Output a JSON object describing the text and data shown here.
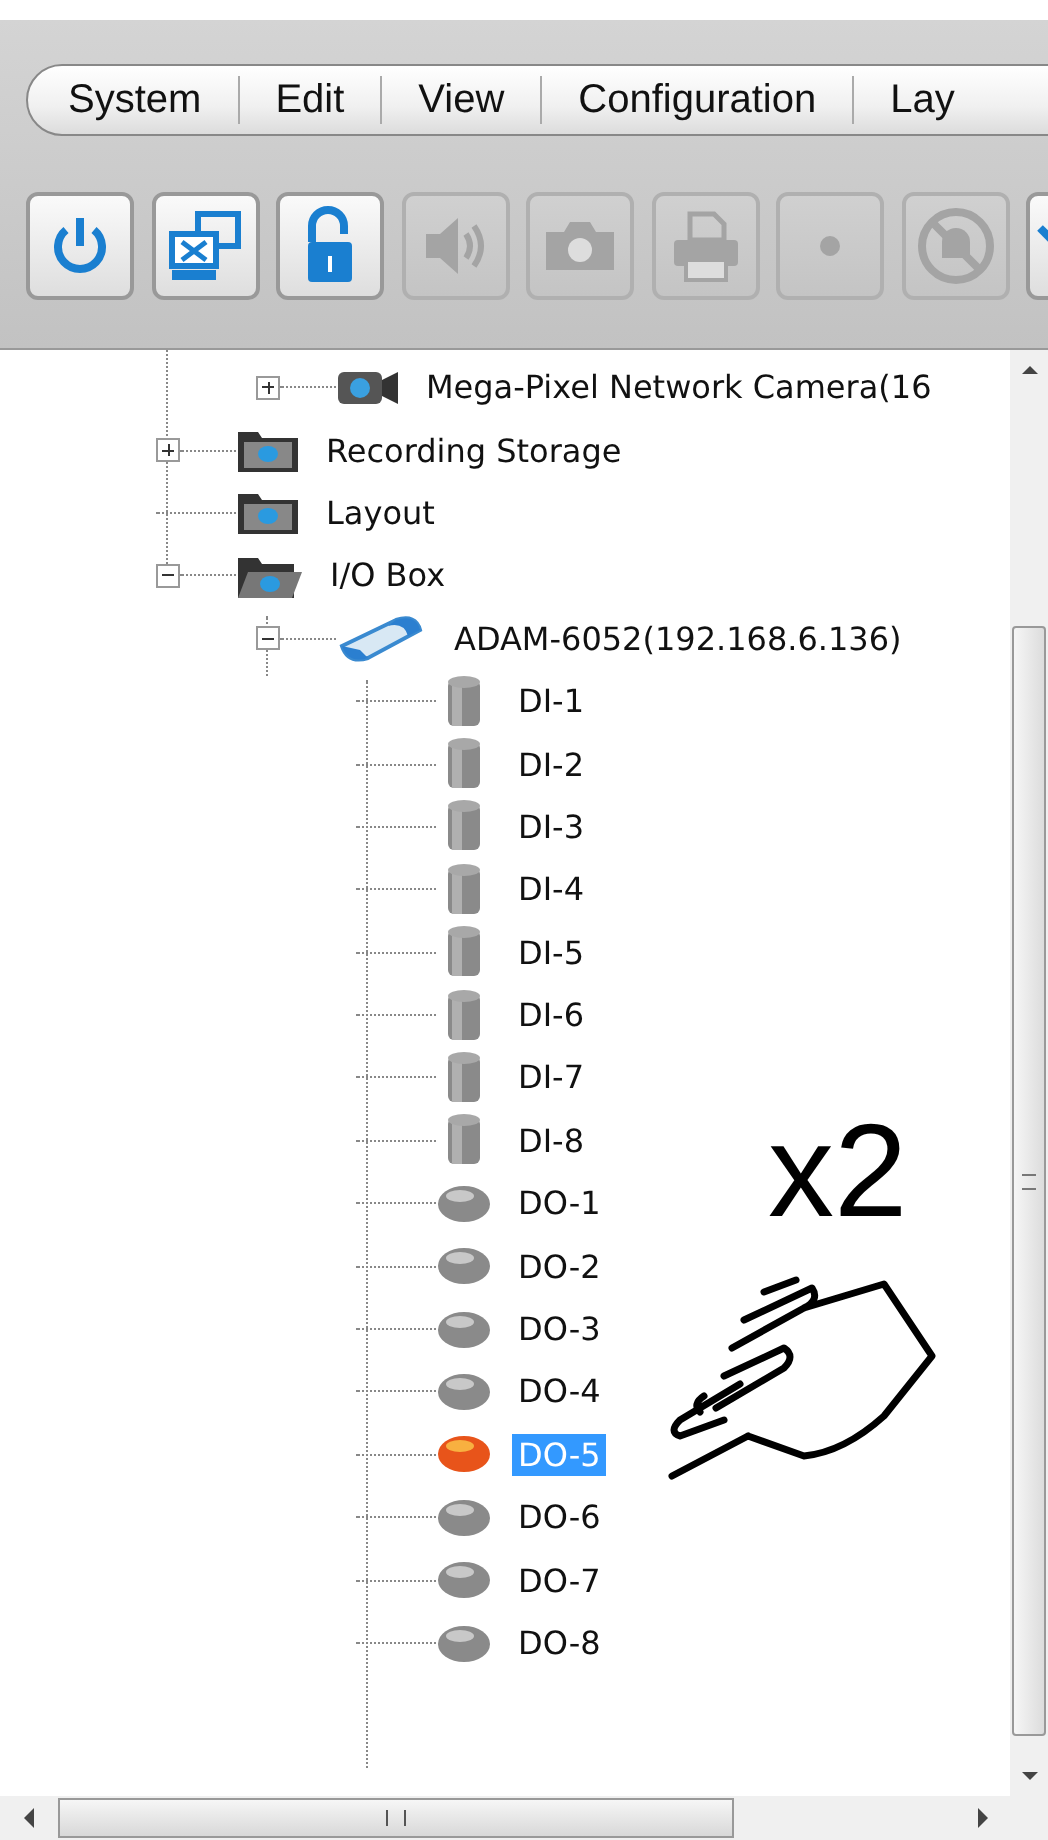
{
  "menu_bar": {
    "items": [
      {
        "label": "System"
      },
      {
        "label": "Edit"
      },
      {
        "label": "View"
      },
      {
        "label": "Configuration"
      },
      {
        "label": "Lay"
      }
    ]
  },
  "toolbar": {
    "buttons": [
      {
        "kind": "power",
        "disabled": false
      },
      {
        "kind": "network",
        "disabled": false
      },
      {
        "kind": "lock",
        "disabled": false
      },
      {
        "kind": "speaker",
        "disabled": true
      },
      {
        "kind": "camera",
        "disabled": true
      },
      {
        "kind": "printer",
        "disabled": true
      },
      {
        "kind": "record",
        "disabled": true
      },
      {
        "kind": "mute",
        "disabled": true
      },
      {
        "kind": "partial",
        "disabled": false
      }
    ]
  },
  "tree": {
    "scrolled_branch_items": [
      {
        "label": "Mega-Pixel Network Camera(16",
        "kind": "camera",
        "expanded": false,
        "selected": false
      }
    ],
    "items": [
      {
        "label": "Recording Storage",
        "kind": "folder",
        "expanded": false,
        "selected": false
      },
      {
        "label": "Layout",
        "kind": "folder",
        "selected": false
      },
      {
        "label": "I/O Box",
        "kind": "folder-open",
        "expanded": true,
        "selected": false,
        "children": [
          {
            "label": "ADAM-6052(192.168.6.136)",
            "kind": "module",
            "expanded": true,
            "selected": false,
            "children": [
              {
                "label": "DI-1",
                "kind": "input",
                "selected": false
              },
              {
                "label": "DI-2",
                "kind": "input",
                "selected": false
              },
              {
                "label": "DI-3",
                "kind": "input",
                "selected": false
              },
              {
                "label": "DI-4",
                "kind": "input",
                "selected": false
              },
              {
                "label": "DI-5",
                "kind": "input",
                "selected": false
              },
              {
                "label": "DI-6",
                "kind": "input",
                "selected": false
              },
              {
                "label": "DI-7",
                "kind": "input",
                "selected": false
              },
              {
                "label": "DI-8",
                "kind": "input",
                "selected": false
              },
              {
                "label": "DO-1",
                "kind": "output",
                "on": false,
                "selected": false
              },
              {
                "label": "DO-2",
                "kind": "output",
                "on": false,
                "selected": false
              },
              {
                "label": "DO-3",
                "kind": "output",
                "on": false,
                "selected": false
              },
              {
                "label": "DO-4",
                "kind": "output",
                "on": false,
                "selected": false
              },
              {
                "label": "DO-5",
                "kind": "output",
                "on": true,
                "selected": true
              },
              {
                "label": "DO-6",
                "kind": "output",
                "on": false,
                "selected": false
              },
              {
                "label": "DO-7",
                "kind": "output",
                "on": false,
                "selected": false
              },
              {
                "label": "DO-8",
                "kind": "output",
                "on": false,
                "selected": false
              }
            ]
          }
        ]
      }
    ]
  },
  "annotation": {
    "text": "x2"
  }
}
